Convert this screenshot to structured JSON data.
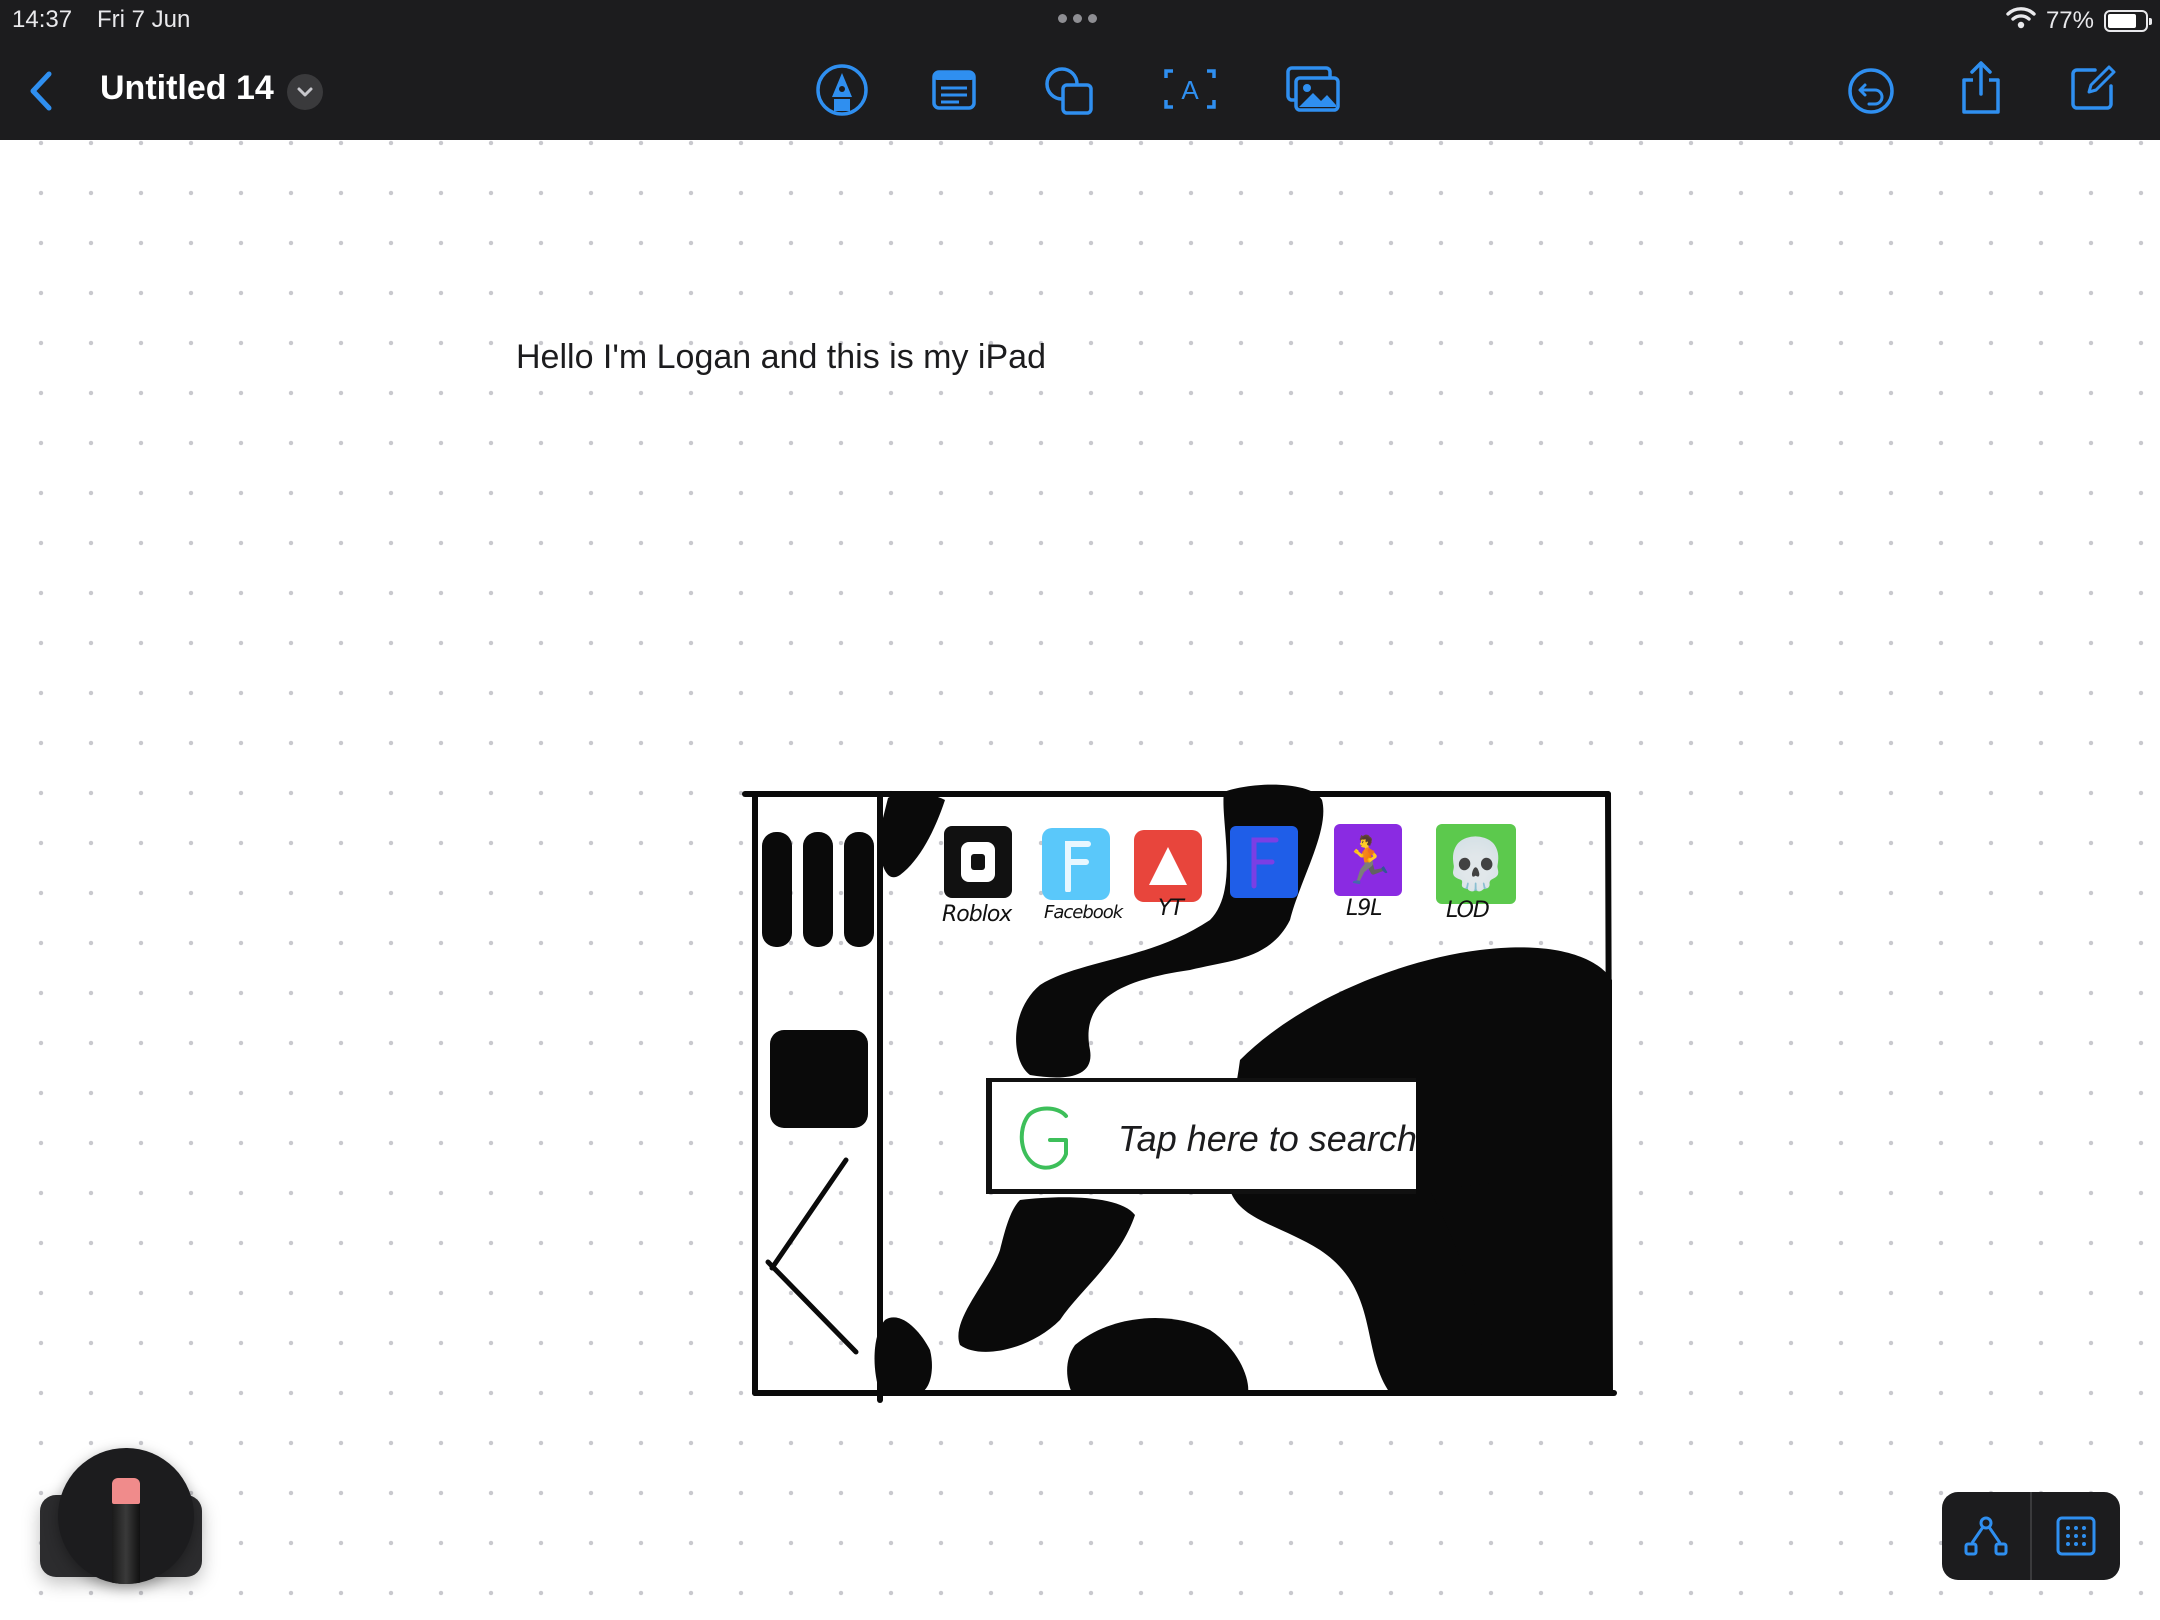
{
  "status_bar": {
    "time": "14:37",
    "date": "Fri 7 Jun",
    "battery": "77%",
    "battery_level": 0.77
  },
  "toolbar": {
    "title": "Untitled 14",
    "accent_color": "#2f8ff0",
    "tools": [
      "pen-tool-icon",
      "text-box-icon",
      "shapes-icon",
      "text-insert-icon",
      "media-icon"
    ],
    "actions": [
      "undo-icon",
      "share-icon",
      "compose-icon"
    ]
  },
  "board": {
    "text": "Hello I'm Logan and this is my iPad"
  },
  "sketch": {
    "apps": [
      {
        "label": "Roblox",
        "color": "#111111"
      },
      {
        "label": "Facebook",
        "color": "#5ac8fa"
      },
      {
        "label": "YT",
        "color": "#e8453c"
      },
      {
        "label": "",
        "color": "#1f5ee8"
      },
      {
        "label": "L9L",
        "color": "#8a2be2"
      },
      {
        "label": "LOD",
        "color": "#5cc94d"
      }
    ],
    "search_placeholder": "Tap here to search"
  },
  "floating": {
    "pencil_tip_color": "#f08b8b",
    "tools": [
      "connector-icon",
      "grid-icon"
    ]
  }
}
